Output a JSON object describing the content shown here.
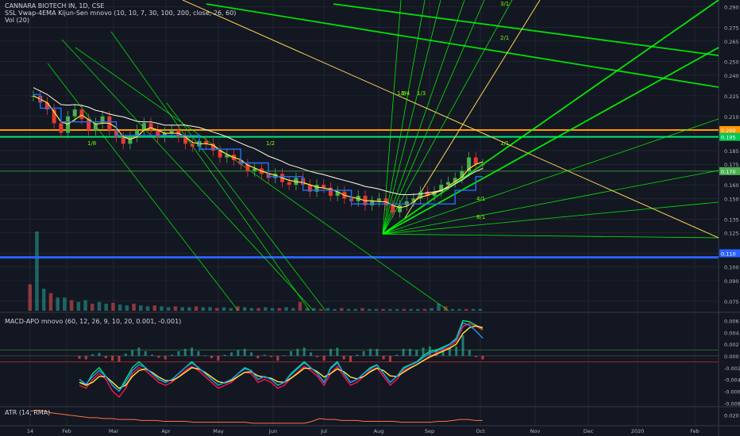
{
  "header": {
    "title": "CANNARA BIOTECH IN, 1D, CSE",
    "ssl_indicator": "SSL Vwap-4EMA Kijun-Sen mnovo (10, 10, 7, 30, 100, 200, close, 26, 60)",
    "vol_indicator": "Vol (20)"
  },
  "macd_panel": {
    "label": "MACD-APO mnovo (60, 12, 26, 9, 10, 20, 0.001, -0.001)"
  },
  "atr_panel": {
    "label": "ATR (14, RMA)"
  },
  "colors": {
    "background": "#131722",
    "grid": "#2a2e39",
    "axis_text": "#b2b5be",
    "candle_up": "#26a69a",
    "candle_down": "#ef5350",
    "fan_green": "#00ff00",
    "fan_yellow": "#ffd54f",
    "ssl_blue": "#1e6fff",
    "vwap_white": "#ffffe0",
    "ema_yellow": "#ffeb3b",
    "level_orange": "#ff9800",
    "level_green": "#00e676",
    "level_blue": "#2962ff"
  },
  "chart_data": [
    {
      "type": "candlestick",
      "title": "CANNARA BIOTECH IN, 1D, CSE",
      "x_axis": {
        "tick_labels": [
          "14",
          "Feb",
          "Mar",
          "Apr",
          "May",
          "Jun",
          "Jul",
          "Aug",
          "Sep",
          "Oct",
          "Nov",
          "Dec",
          "2020",
          "Feb"
        ]
      },
      "y_axis": {
        "tick_labels": [
          "0.290",
          "0.275",
          "0.265",
          "0.250",
          "0.240",
          "0.225",
          "0.210",
          "0.200",
          "0.185",
          "0.175",
          "0.160",
          "0.150",
          "0.135",
          "0.125",
          "0.110",
          "0.100",
          "0.090",
          "0.075"
        ],
        "range": [
          0.068,
          0.295
        ]
      },
      "price_tags": [
        {
          "value": "0.200",
          "color": "#ff9800"
        },
        {
          "value": "0.195",
          "color": "#00c853"
        },
        {
          "value": "0.170",
          "color": "#4caf50"
        },
        {
          "value": "0.110",
          "color": "#2962ff"
        }
      ],
      "horizontal_levels": [
        0.2,
        0.195,
        0.17,
        0.107
      ],
      "close_series": [
        0.225,
        0.22,
        0.215,
        0.205,
        0.198,
        0.21,
        0.215,
        0.208,
        0.2,
        0.205,
        0.21,
        0.2,
        0.195,
        0.19,
        0.195,
        0.2,
        0.205,
        0.2,
        0.195,
        0.198,
        0.2,
        0.195,
        0.19,
        0.188,
        0.192,
        0.19,
        0.185,
        0.18,
        0.182,
        0.178,
        0.175,
        0.17,
        0.172,
        0.168,
        0.165,
        0.168,
        0.162,
        0.16,
        0.165,
        0.16,
        0.155,
        0.16,
        0.158,
        0.152,
        0.155,
        0.15,
        0.148,
        0.152,
        0.145,
        0.148,
        0.15,
        0.145,
        0.14,
        0.145,
        0.148,
        0.15,
        0.155,
        0.152,
        0.155,
        0.16,
        0.162,
        0.165,
        0.17,
        0.18,
        0.175,
        0.175
      ],
      "fan_labels": [
        "3/1",
        "2/1",
        "1/1",
        "1/2",
        "1/3",
        "1/4",
        "1/8",
        "4/1",
        "8/1"
      ]
    },
    {
      "type": "bar",
      "title": "Vol (20)",
      "values": [
        0.3,
        0.9,
        0.25,
        0.2,
        0.15,
        0.15,
        0.12,
        0.1,
        0.12,
        0.08,
        0.1,
        0.08,
        0.09,
        0.07,
        0.06,
        0.08,
        0.06,
        0.05,
        0.06,
        0.05,
        0.04,
        0.05,
        0.04,
        0.04,
        0.05,
        0.04,
        0.04,
        0.03,
        0.04,
        0.03,
        0.05,
        0.04,
        0.03,
        0.03,
        0.04,
        0.03,
        0.03,
        0.04,
        0.03,
        0.1,
        0.03,
        0.03,
        0.02,
        0.03,
        0.02,
        0.03,
        0.02,
        0.02,
        0.03,
        0.02,
        0.02,
        0.02,
        0.02,
        0.02,
        0.02,
        0.02,
        0.02,
        0.02,
        0.03,
        0.08,
        0.05,
        0.02,
        0.02,
        0.02,
        0.02,
        0.02
      ]
    },
    {
      "type": "line",
      "title": "MACD-APO mnovo (60, 12, 26, 9, 10, 20, 0.001, -0.001)",
      "y_axis": {
        "tick_labels": [
          "0.006",
          "0.004",
          "0.002",
          "0.000",
          "-0.002",
          "-0.004",
          "-0.006",
          "-0.008"
        ],
        "range": [
          -0.0085,
          0.007
        ]
      },
      "series": [
        {
          "color": "#00e676",
          "values": [
            -0.004,
            -0.005,
            -0.003,
            -0.002,
            -0.0035,
            -0.005,
            -0.006,
            -0.004,
            -0.002,
            -0.001,
            -0.002,
            -0.003,
            -0.004,
            -0.0045,
            -0.004,
            -0.003,
            -0.002,
            -0.001,
            -0.002,
            -0.003,
            -0.004,
            -0.005,
            -0.0045,
            -0.004,
            -0.003,
            -0.002,
            -0.0025,
            -0.004,
            -0.0035,
            -0.004,
            -0.005,
            -0.0045,
            -0.003,
            -0.002,
            -0.001,
            -0.002,
            -0.003,
            -0.0045,
            -0.002,
            -0.001,
            -0.003,
            -0.0045,
            -0.004,
            -0.003,
            -0.002,
            -0.0015,
            -0.003,
            -0.0045,
            -0.0035,
            -0.002,
            -0.0015,
            -0.001,
            0.0,
            0.0008,
            0.001,
            0.0015,
            0.002,
            0.003,
            0.006,
            0.0058,
            0.0052,
            0.0045
          ]
        },
        {
          "color": "#ff1744",
          "values": [
            -0.005,
            -0.0055,
            -0.004,
            -0.003,
            -0.004,
            -0.006,
            -0.007,
            -0.0055,
            -0.003,
            -0.002,
            -0.0025,
            -0.0035,
            -0.0045,
            -0.005,
            -0.0045,
            -0.0035,
            -0.0025,
            -0.0018,
            -0.0025,
            -0.0035,
            -0.0045,
            -0.0055,
            -0.005,
            -0.0045,
            -0.0035,
            -0.0028,
            -0.003,
            -0.0045,
            -0.004,
            -0.0045,
            -0.0055,
            -0.005,
            -0.0038,
            -0.0028,
            -0.0018,
            -0.0025,
            -0.0035,
            -0.005,
            -0.003,
            -0.0018,
            -0.0035,
            -0.005,
            -0.0045,
            -0.0035,
            -0.0025,
            -0.002,
            -0.0035,
            -0.005,
            -0.004,
            -0.0025,
            -0.002,
            -0.0015,
            -0.0008,
            0.0,
            0.0005,
            0.001,
            0.0015,
            0.0025,
            0.005,
            0.0055,
            0.005,
            0.0044
          ]
        },
        {
          "color": "#ffeb3b",
          "values": [
            -0.0045,
            -0.005,
            -0.0045,
            -0.0035,
            -0.0035,
            -0.0045,
            -0.0055,
            -0.005,
            -0.0035,
            -0.0025,
            -0.0022,
            -0.0028,
            -0.0036,
            -0.0042,
            -0.0042,
            -0.0036,
            -0.0028,
            -0.002,
            -0.0022,
            -0.0028,
            -0.0036,
            -0.0044,
            -0.0046,
            -0.0042,
            -0.0035,
            -0.0028,
            -0.0027,
            -0.0034,
            -0.0036,
            -0.0038,
            -0.0044,
            -0.0045,
            -0.0038,
            -0.003,
            -0.0021,
            -0.0021,
            -0.0027,
            -0.0036,
            -0.003,
            -0.0022,
            -0.0027,
            -0.0036,
            -0.0039,
            -0.0035,
            -0.0027,
            -0.0021,
            -0.0025,
            -0.0034,
            -0.0035,
            -0.0028,
            -0.0021,
            -0.0015,
            -0.0008,
            -0.0002,
            0.0003,
            0.0008,
            0.0013,
            0.002,
            0.0038,
            0.0048,
            0.0051,
            0.0048
          ]
        },
        {
          "color": "#2196f3",
          "values": [
            -0.004,
            -0.0048,
            -0.0035,
            -0.0025,
            -0.0035,
            -0.005,
            -0.006,
            -0.0045,
            -0.0025,
            -0.0015,
            -0.002,
            -0.003,
            -0.004,
            -0.0045,
            -0.004,
            -0.003,
            -0.002,
            -0.0012,
            -0.002,
            -0.003,
            -0.004,
            -0.005,
            -0.0045,
            -0.004,
            -0.003,
            -0.0022,
            -0.0025,
            -0.004,
            -0.0035,
            -0.004,
            -0.005,
            -0.0045,
            -0.0032,
            -0.0022,
            -0.0012,
            -0.002,
            -0.003,
            -0.0045,
            -0.0022,
            -0.0012,
            -0.003,
            -0.0045,
            -0.004,
            -0.003,
            -0.0022,
            -0.0016,
            -0.003,
            -0.0045,
            -0.0035,
            -0.0022,
            -0.0016,
            -0.0011,
            -0.0003,
            0.0005,
            0.0008,
            0.0013,
            0.0019,
            0.0028,
            0.0056,
            0.0052,
            0.0042,
            0.003
          ]
        }
      ],
      "histogram": [
        -0.0005,
        -0.0006,
        0.0003,
        0.0005,
        -0.0004,
        -0.0008,
        -0.001,
        0.0004,
        0.001,
        0.0014,
        0.0008,
        0.0002,
        -0.0003,
        -0.0006,
        0.0002,
        0.0008,
        0.0012,
        0.0014,
        0.0008,
        0.0001,
        -0.0004,
        -0.0008,
        0.0002,
        0.0006,
        0.001,
        0.0012,
        0.0006,
        -0.0004,
        0.0002,
        -0.0002,
        -0.0008,
        0.0001,
        0.0008,
        0.0012,
        0.0014,
        0.0006,
        -0.0002,
        -0.0008,
        0.0012,
        0.0014,
        -0.0006,
        -0.001,
        0.0002,
        0.0008,
        0.0012,
        0.0012,
        -0.0006,
        -0.001,
        0.0002,
        0.0012,
        0.0012,
        0.001,
        0.0014,
        0.0016,
        0.0012,
        0.0012,
        0.0014,
        0.0016,
        0.0035,
        0.001,
        -0.0002,
        -0.0006
      ]
    },
    {
      "type": "line",
      "title": "ATR (14, RMA)",
      "y_axis": {
        "tick_labels": [
          "0.020"
        ],
        "range": [
          0.01,
          0.028
        ]
      },
      "values": [
        0.024,
        0.025,
        0.024,
        0.022,
        0.021,
        0.02,
        0.019,
        0.018,
        0.017,
        0.017,
        0.016,
        0.016,
        0.015,
        0.015,
        0.015,
        0.014,
        0.014,
        0.014,
        0.013,
        0.013,
        0.013,
        0.013,
        0.012,
        0.012,
        0.012,
        0.012,
        0.012,
        0.012,
        0.012,
        0.012,
        0.011,
        0.011,
        0.011,
        0.011,
        0.011,
        0.011,
        0.011,
        0.011,
        0.013,
        0.016,
        0.015,
        0.015,
        0.014,
        0.014,
        0.014,
        0.013,
        0.013,
        0.013,
        0.013,
        0.013,
        0.012,
        0.012,
        0.012,
        0.012,
        0.012,
        0.013,
        0.013,
        0.014,
        0.015,
        0.015,
        0.014,
        0.014
      ]
    }
  ]
}
